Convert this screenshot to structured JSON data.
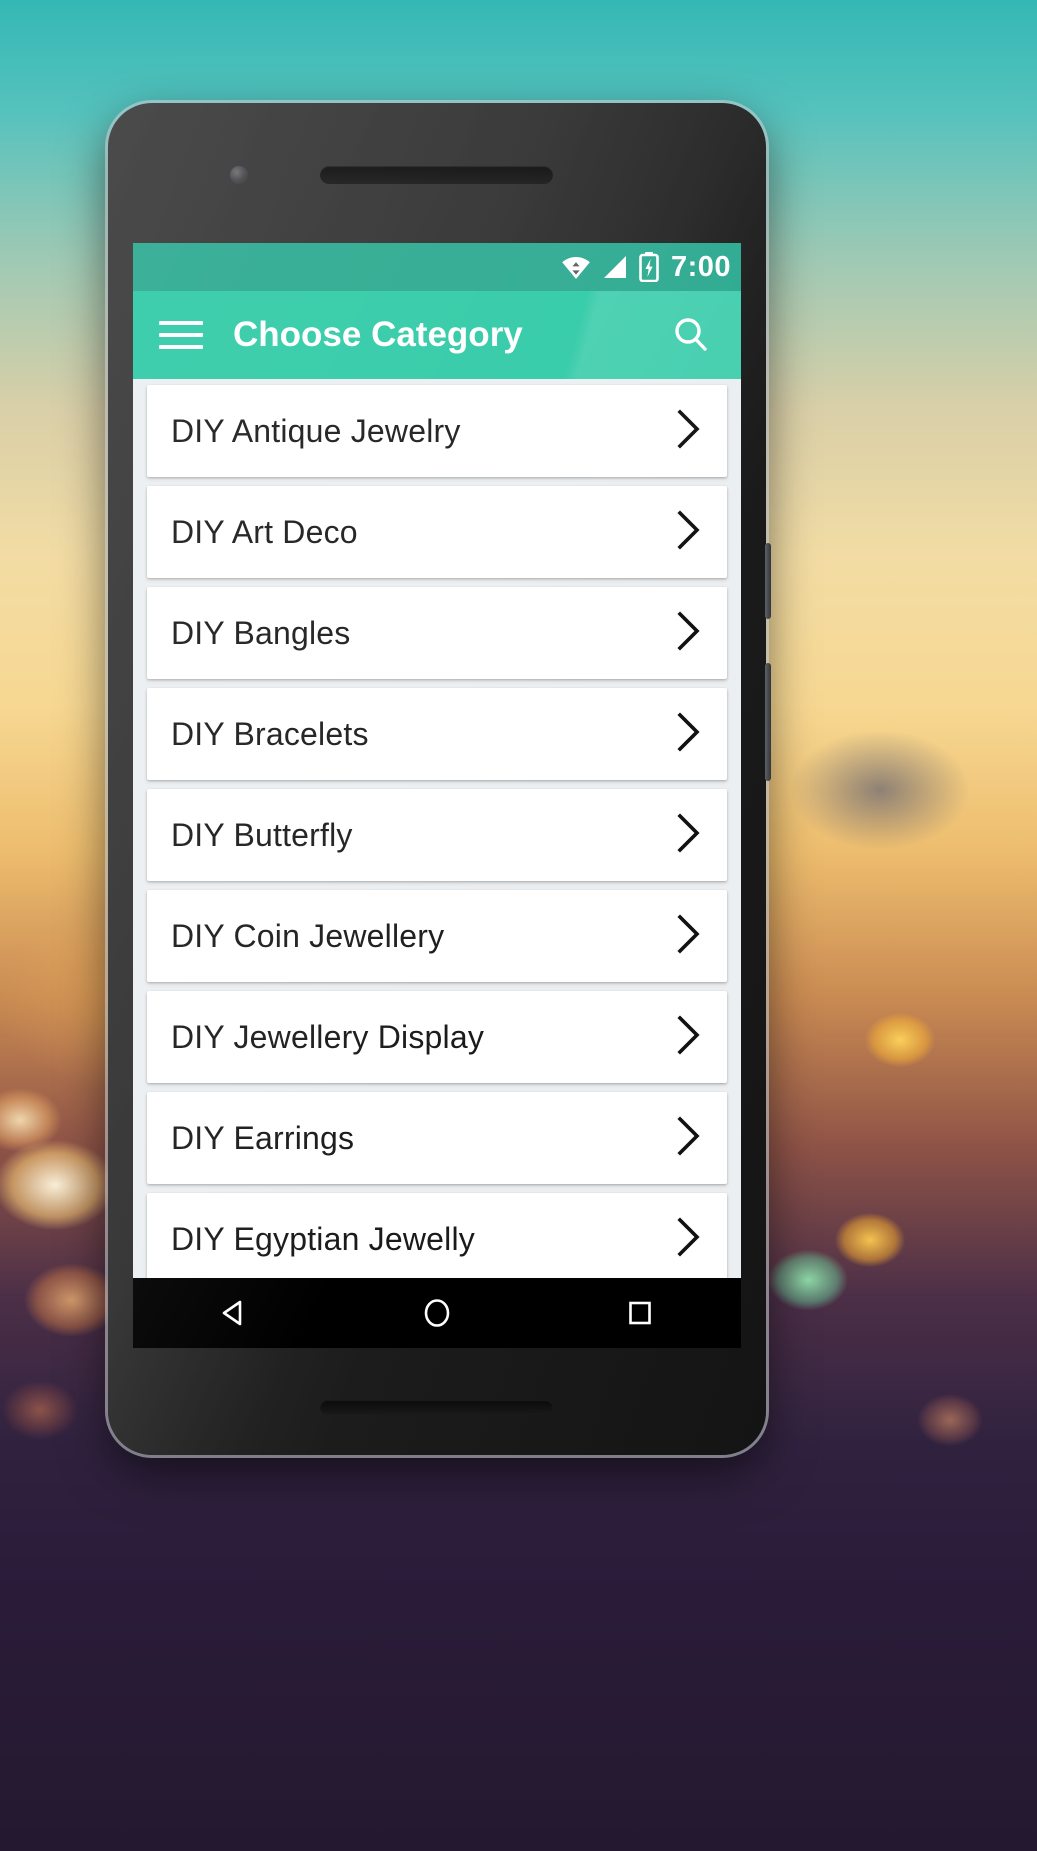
{
  "wallpaper": {
    "description": "blurred bokeh sunset photograph",
    "colors": {
      "top_teal": "#34b8b5",
      "mid_gold": "#f7d892",
      "bottom_purple": "#241830"
    }
  },
  "device": {
    "name": "android-smartphone",
    "frame_color": "#2e2e2e",
    "components": {
      "front_camera": "front-camera",
      "earpiece": "earpiece-speaker",
      "bottom_speaker": "bottom-speaker",
      "power_button": "power-button",
      "volume_button": "volume-rocker"
    }
  },
  "status_bar": {
    "background": "#2ba98f",
    "clock": "7:00",
    "icons": [
      {
        "name": "wifi-icon",
        "label": "wifi"
      },
      {
        "name": "signal-icon",
        "label": "cellular-signal"
      },
      {
        "name": "battery-charging-icon",
        "label": "battery-charging"
      }
    ]
  },
  "app_bar": {
    "background": "#2fcaa6",
    "title": "Choose Category",
    "menu_icon": "hamburger-menu-icon",
    "search_icon": "search-icon",
    "text_color": "#ffffff"
  },
  "content": {
    "background": "#eceff1",
    "card_background": "#ffffff",
    "chevron_icon": "chevron-right-icon",
    "categories": [
      {
        "label": "DIY Antique Jewelry"
      },
      {
        "label": "DIY Art Deco"
      },
      {
        "label": "DIY Bangles"
      },
      {
        "label": "DIY Bracelets"
      },
      {
        "label": "DIY Butterfly"
      },
      {
        "label": "DIY Coin Jewellery"
      },
      {
        "label": "DIY Jewellery Display"
      },
      {
        "label": "DIY Earrings"
      },
      {
        "label": "DIY Egyptian Jewelly"
      }
    ]
  },
  "nav_bar": {
    "background": "#000000",
    "buttons": [
      {
        "name": "back-button",
        "icon": "triangle-left-icon"
      },
      {
        "name": "home-button",
        "icon": "circle-icon"
      },
      {
        "name": "recents-button",
        "icon": "square-icon"
      }
    ]
  }
}
